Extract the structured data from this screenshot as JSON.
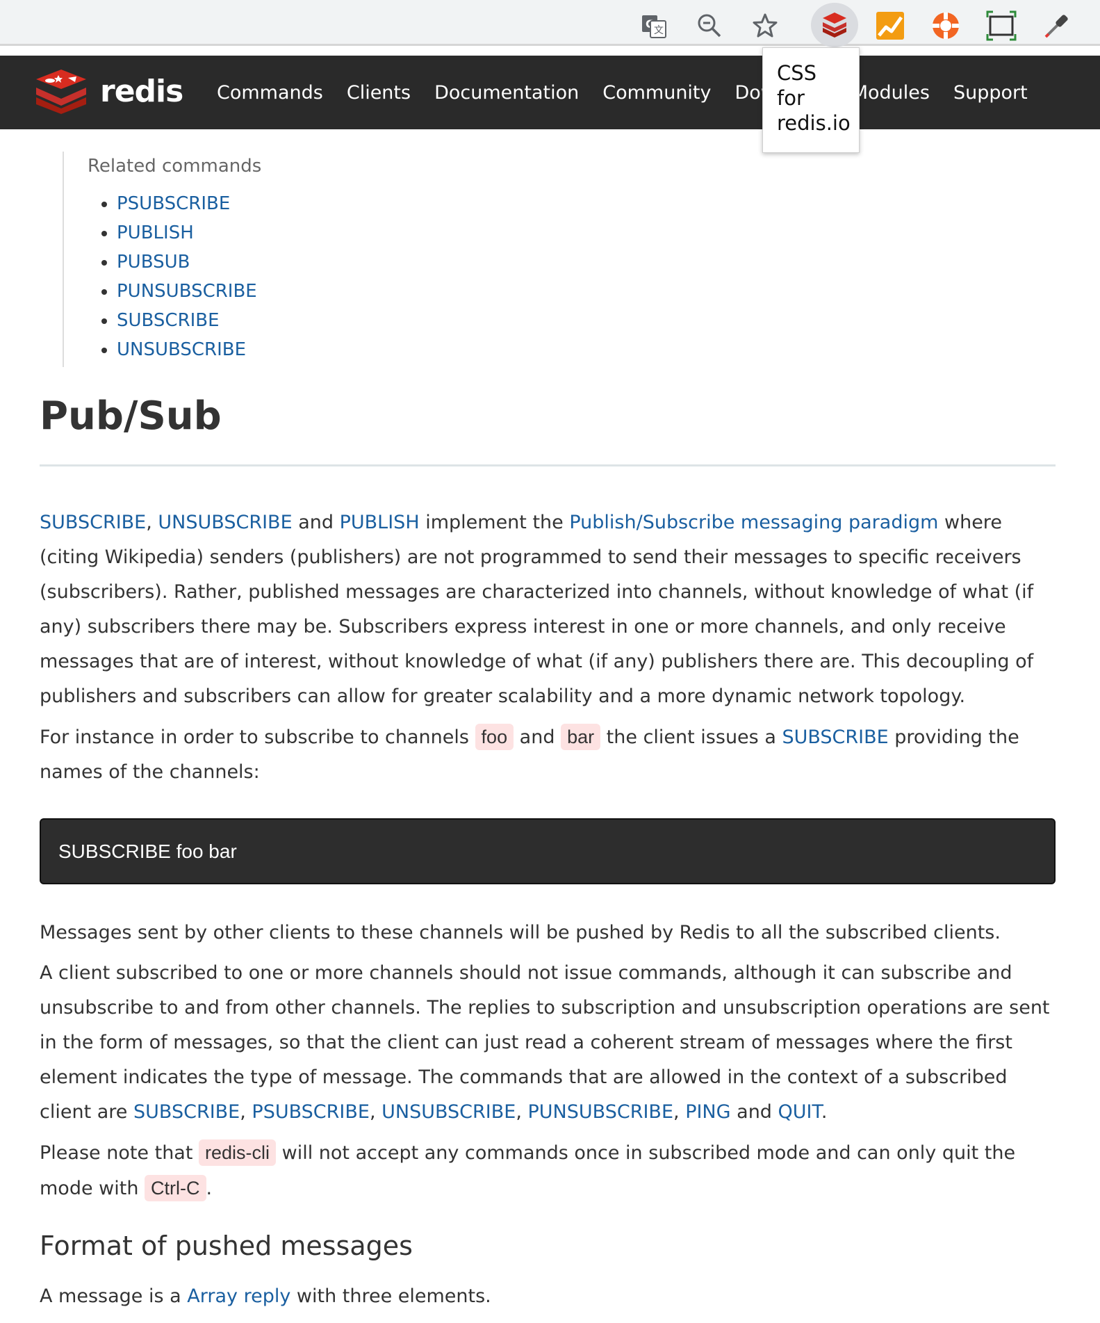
{
  "browser": {
    "tooltip_lines": [
      "CSS",
      "for",
      "redis.io"
    ]
  },
  "nav": {
    "brand": "redis",
    "items": [
      "Commands",
      "Clients",
      "Documentation",
      "Community",
      "Download",
      "Modules",
      "Support"
    ]
  },
  "related": {
    "title": "Related commands",
    "items": [
      "PSUBSCRIBE",
      "PUBLISH",
      "PUBSUB",
      "PUNSUBSCRIBE",
      "SUBSCRIBE",
      "UNSUBSCRIBE"
    ]
  },
  "article": {
    "title": "Pub/Sub",
    "p1": {
      "link1": "SUBSCRIBE",
      "sep1": ", ",
      "link2": "UNSUBSCRIBE",
      "t1": " and ",
      "link3": "PUBLISH",
      "t2": " implement the ",
      "link4": "Publish/Subscribe messaging paradigm",
      "t3": " where (citing Wikipedia) senders (publishers) are not programmed to send their messages to specific receivers (subscribers). Rather, published messages are characterized into channels, without knowledge of what (if any) subscribers there may be. Subscribers express interest in one or more channels, and only receive messages that are of interest, without knowledge of what (if any) publishers there are. This decoupling of publishers and subscribers can allow for greater scalability and a more dynamic network topology."
    },
    "p2": {
      "t1": "For instance in order to subscribe to channels ",
      "code1": "foo",
      "t2": " and ",
      "code2": "bar",
      "t3": " the client issues a ",
      "link1": "SUBSCRIBE",
      "t4": " providing the names of the channels:"
    },
    "code_block": "SUBSCRIBE foo bar",
    "p3": "Messages sent by other clients to these channels will be pushed by Redis to all the subscribed clients.",
    "p4": {
      "t1": "A client subscribed to one or more channels should not issue commands, although it can subscribe and unsubscribe to and from other channels. The replies to subscription and unsubscription operations are sent in the form of messages, so that the client can just read a coherent stream of messages where the first element indicates the type of message. The commands that are allowed in the context of a subscribed client are ",
      "link1": "SUBSCRIBE",
      "s1": ", ",
      "link2": "PSUBSCRIBE",
      "s2": ", ",
      "link3": "UNSUBSCRIBE",
      "s3": ", ",
      "link4": "PUNSUBSCRIBE",
      "s4": ", ",
      "link5": "PING",
      "t2": " and ",
      "link6": "QUIT",
      "t3": "."
    },
    "p5": {
      "t1": "Please note that ",
      "code1": "redis-cli",
      "t2": " will not accept any commands once in subscribed mode and can only quit the mode with ",
      "code2": "Ctrl-C",
      "t3": "."
    },
    "h2": "Format of pushed messages",
    "p6": {
      "t1": "A message is a ",
      "link1": "Array reply",
      "t2": " with three elements."
    }
  }
}
